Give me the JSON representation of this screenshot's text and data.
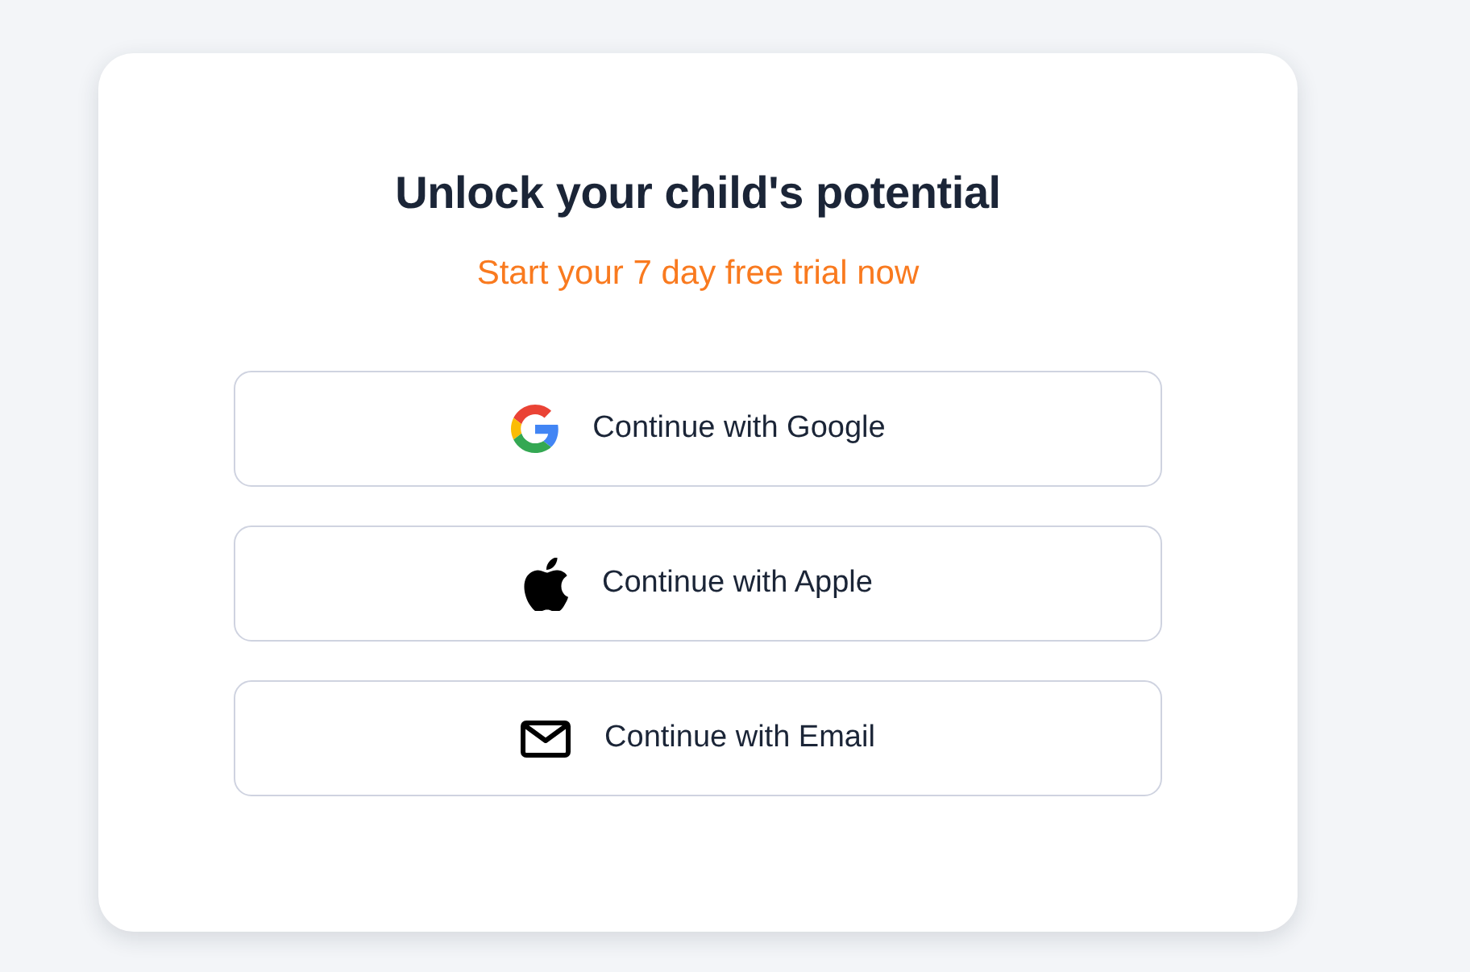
{
  "card": {
    "title": "Unlock your child's potential",
    "subtitle": "Start your 7 day free trial now"
  },
  "buttons": [
    {
      "kind": "google",
      "label": "Continue with Google"
    },
    {
      "kind": "apple",
      "label": "Continue with Apple"
    },
    {
      "kind": "email",
      "label": "Continue with Email"
    }
  ]
}
